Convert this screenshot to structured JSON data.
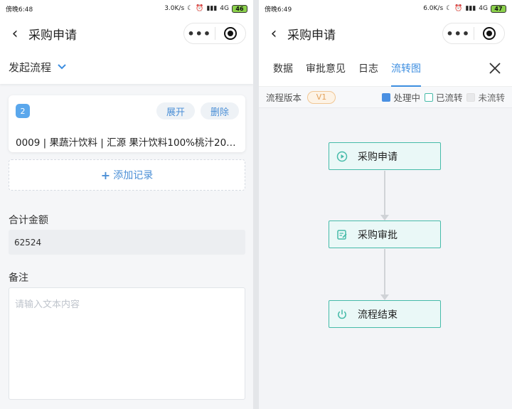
{
  "left": {
    "status": {
      "time": "傍晚6:48",
      "speed": "3.0K/s",
      "network": "4G",
      "battery": "46"
    },
    "title": "采购申请",
    "capsule": {
      "more": "•••"
    },
    "flow_selector": "发起流程",
    "record": {
      "index": "2",
      "expand_label": "展开",
      "delete_label": "删除",
      "text": "0009 | 果蔬汁饮料 | 汇源 果汁饮料100%桃汁20…"
    },
    "add_record_label": "添加记录",
    "total_amount": {
      "label": "合计金额",
      "value": "62524"
    },
    "remark": {
      "label": "备注",
      "placeholder": "请输入文本内容"
    }
  },
  "right": {
    "status": {
      "time": "傍晚6:49",
      "speed": "6.0K/s",
      "network": "4G",
      "battery": "47"
    },
    "title": "采购申请",
    "capsule": {
      "more": "•••"
    },
    "tabs": [
      "数据",
      "审批意见",
      "日志",
      "流转图"
    ],
    "active_tab": "流转图",
    "version": {
      "label": "流程版本",
      "value": "V1"
    },
    "legend": [
      "处理中",
      "已流转",
      "未流转"
    ],
    "nodes": [
      "采购申请",
      "采购审批",
      "流程结束"
    ]
  },
  "colors": {
    "accent": "#3d8ee0",
    "node_border": "#46bba9",
    "node_fill": "#eaf8f7",
    "version_badge": "#e2a15b"
  }
}
